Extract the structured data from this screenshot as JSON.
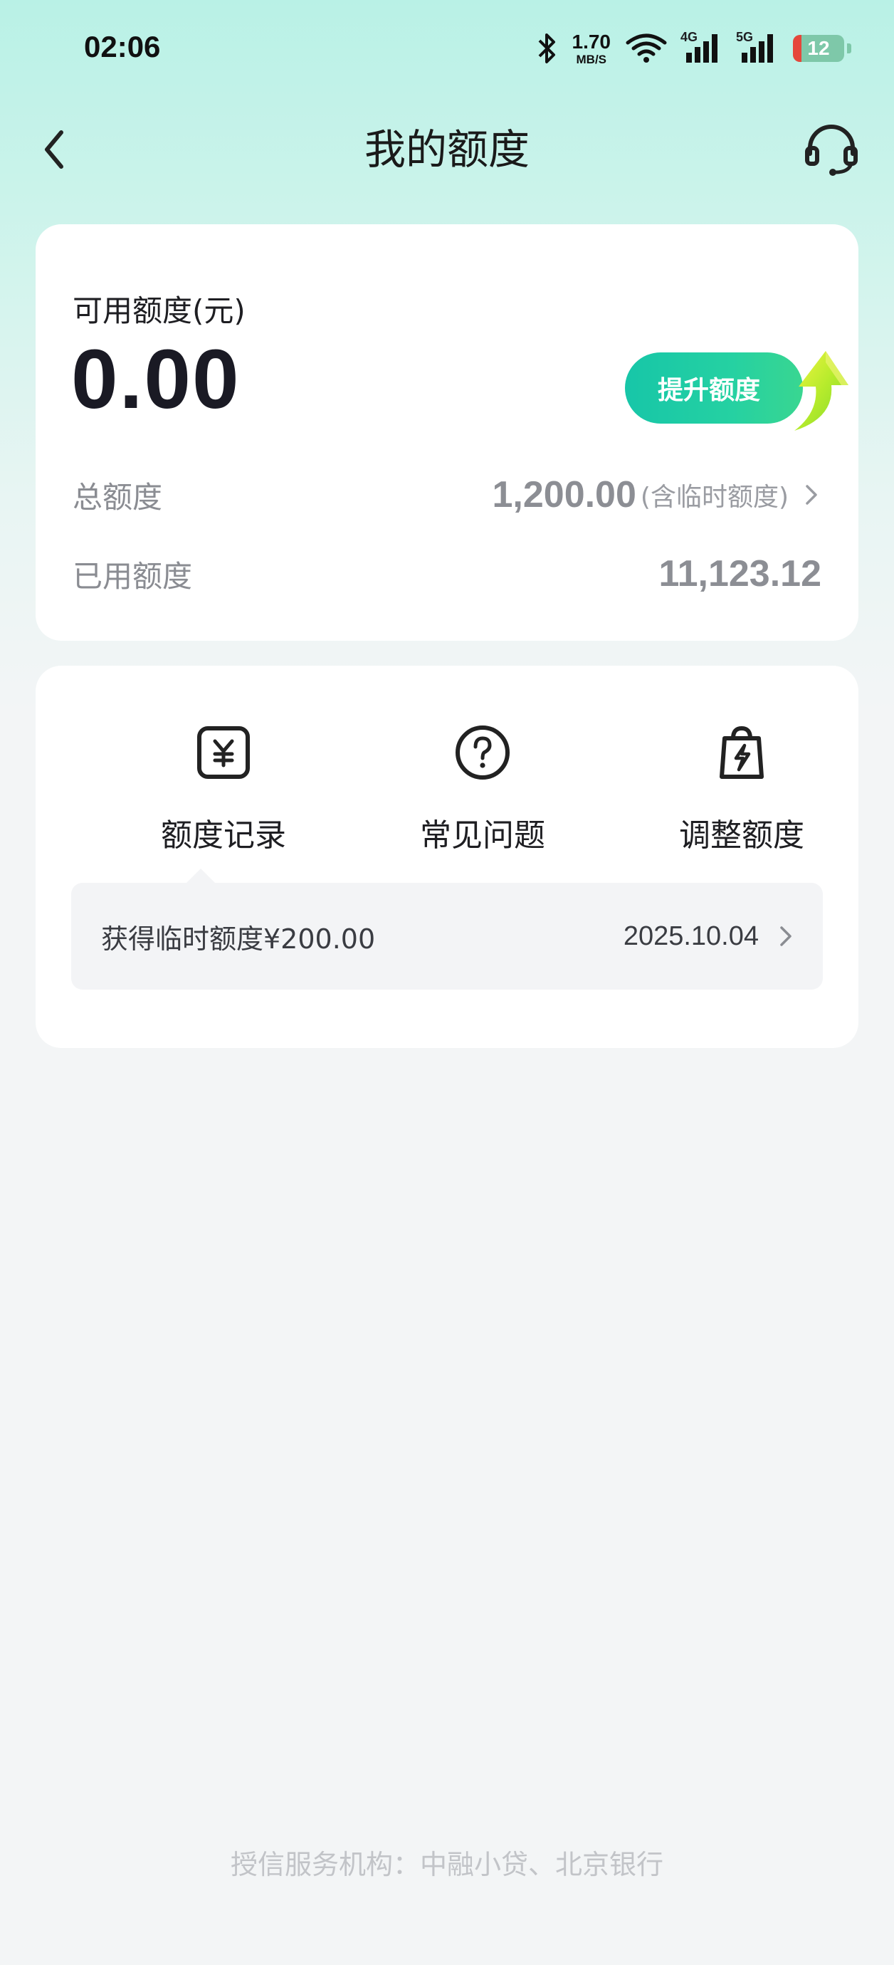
{
  "status_bar": {
    "time": "02:06",
    "net_speed_value": "1.70",
    "net_speed_unit": "MB/S",
    "sim1_tag": "4G",
    "sim2_tag": "5G",
    "battery_level": "12"
  },
  "nav": {
    "title": "我的额度"
  },
  "quota": {
    "available_label": "可用额度(元)",
    "available_amount": "0.00",
    "upgrade_label": "提升额度",
    "total_label": "总额度",
    "total_value": "1,200.00",
    "total_note": "(含临时额度)",
    "used_label": "已用额度",
    "used_value": "11,123.12"
  },
  "menu": {
    "items": [
      {
        "label": "额度记录",
        "icon": "yuan-receipt-icon"
      },
      {
        "label": "常见问题",
        "icon": "question-circle-icon"
      },
      {
        "label": "调整额度",
        "icon": "lightning-bag-icon"
      }
    ]
  },
  "notice": {
    "text": "获得临时额度¥200.00",
    "date": "2025.10.04"
  },
  "footer": {
    "text": "授信服务机构：中融小贷、北京银行"
  },
  "colors": {
    "accent_green": "#17c6a8",
    "header_gradient": "#b9f1e6"
  }
}
